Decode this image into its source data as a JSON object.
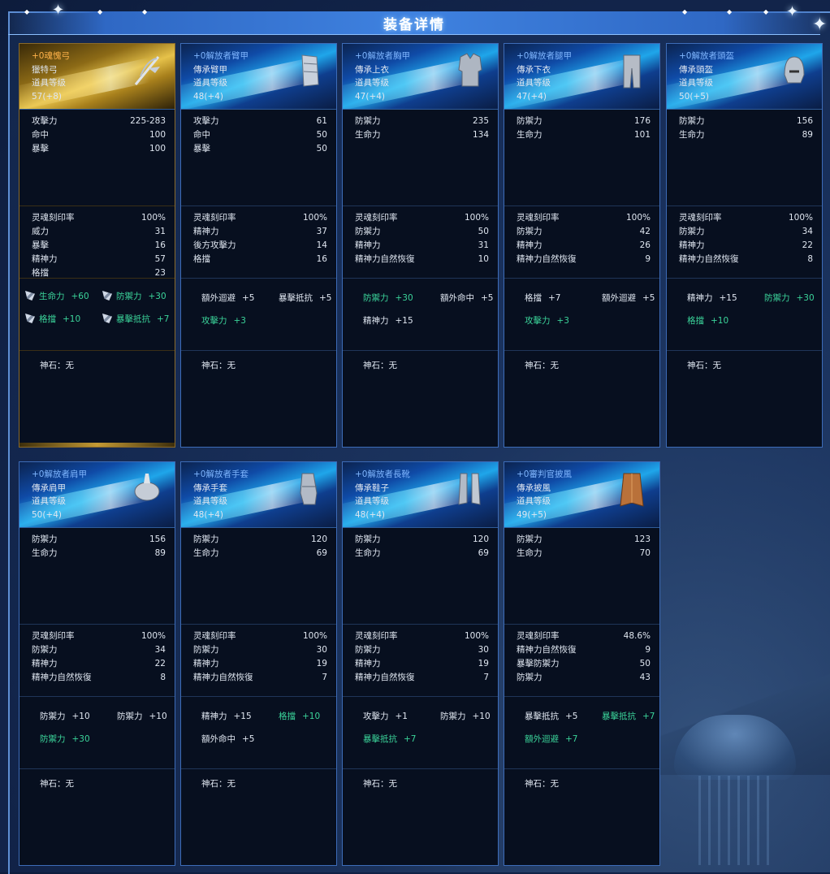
{
  "title": "装备详情",
  "stone_label": "神石",
  "stone_sep": "：",
  "cards": [
    {
      "name": "+0魂愧弓",
      "type": "獵特弓",
      "level_label": "道具等级",
      "level": "57(+8)",
      "gold": true,
      "icon": "bow-icon",
      "base": [
        [
          "攻擊力",
          "225-283"
        ],
        [
          "命中",
          "100"
        ],
        [
          "暴擊",
          "100"
        ]
      ],
      "extra": [
        [
          "灵魂刻印率",
          "100%"
        ],
        [
          "威力",
          "31"
        ],
        [
          "暴擊",
          "16"
        ],
        [
          "精神力",
          "57"
        ],
        [
          "格擋",
          "23"
        ]
      ],
      "bonus": [
        {
          "n": "生命力",
          "v": "+60",
          "g": true,
          "w": true
        },
        {
          "n": "防禦力",
          "v": "+30",
          "g": true,
          "w": true
        },
        {
          "n": "格擋",
          "v": "+10",
          "g": true,
          "w": true
        },
        {
          "n": "暴擊抵抗",
          "v": "+7",
          "g": true,
          "w": true
        }
      ],
      "stone": "无"
    },
    {
      "name": "+0解放者臂甲",
      "type": "傳承臂甲",
      "level_label": "道具等级",
      "level": "48(+4)",
      "gold": false,
      "icon": "arm-guard-icon",
      "base": [
        [
          "攻擊力",
          "61"
        ],
        [
          "命中",
          "50"
        ],
        [
          "暴擊",
          "50"
        ]
      ],
      "extra": [
        [
          "灵魂刻印率",
          "100%"
        ],
        [
          "精神力",
          "37"
        ],
        [
          "後方攻擊力",
          "14"
        ],
        [
          "格擋",
          "16"
        ]
      ],
      "bonus": [
        {
          "n": "額外迴避",
          "v": "+5",
          "g": false
        },
        {
          "n": "暴擊抵抗",
          "v": "+5",
          "g": false
        },
        {
          "n": "攻擊力",
          "v": "+3",
          "g": true
        }
      ],
      "stone": "无"
    },
    {
      "name": "+0解放者胸甲",
      "type": "傳承上衣",
      "level_label": "道具等级",
      "level": "47(+4)",
      "gold": false,
      "icon": "chest-armor-icon",
      "base": [
        [
          "防禦力",
          "235"
        ],
        [
          "生命力",
          "134"
        ]
      ],
      "extra": [
        [
          "灵魂刻印率",
          "100%"
        ],
        [
          "防禦力",
          "50"
        ],
        [
          "精神力",
          "31"
        ],
        [
          "精神力自然恢復",
          "10"
        ]
      ],
      "bonus": [
        {
          "n": "防禦力",
          "v": "+30",
          "g": true
        },
        {
          "n": "額外命中",
          "v": "+5",
          "g": false
        },
        {
          "n": "精神力",
          "v": "+15",
          "g": false
        }
      ],
      "stone": "无"
    },
    {
      "name": "+0解放者腿甲",
      "type": "傳承下衣",
      "level_label": "道具等级",
      "level": "47(+4)",
      "gold": false,
      "icon": "leg-armor-icon",
      "base": [
        [
          "防禦力",
          "176"
        ],
        [
          "生命力",
          "101"
        ]
      ],
      "extra": [
        [
          "灵魂刻印率",
          "100%"
        ],
        [
          "防禦力",
          "42"
        ],
        [
          "精神力",
          "26"
        ],
        [
          "精神力自然恢復",
          "9"
        ]
      ],
      "bonus": [
        {
          "n": "格擋",
          "v": "+7",
          "g": false
        },
        {
          "n": "額外迴避",
          "v": "+5",
          "g": false
        },
        {
          "n": "攻擊力",
          "v": "+3",
          "g": true
        }
      ],
      "stone": "无"
    },
    {
      "name": "+0解放者頭盔",
      "type": "傳承頭盔",
      "level_label": "道具等级",
      "level": "50(+5)",
      "gold": false,
      "icon": "helmet-icon",
      "base": [
        [
          "防禦力",
          "156"
        ],
        [
          "生命力",
          "89"
        ]
      ],
      "extra": [
        [
          "灵魂刻印率",
          "100%"
        ],
        [
          "防禦力",
          "34"
        ],
        [
          "精神力",
          "22"
        ],
        [
          "精神力自然恢復",
          "8"
        ]
      ],
      "bonus": [
        {
          "n": "精神力",
          "v": "+15",
          "g": false
        },
        {
          "n": "防禦力",
          "v": "+30",
          "g": true
        },
        {
          "n": "格擋",
          "v": "+10",
          "g": true
        }
      ],
      "stone": "无"
    },
    {
      "name": "+0解放者肩甲",
      "type": "傳承肩甲",
      "level_label": "道具等级",
      "level": "50(+4)",
      "gold": false,
      "icon": "shoulder-armor-icon",
      "base": [
        [
          "防禦力",
          "156"
        ],
        [
          "生命力",
          "89"
        ]
      ],
      "extra": [
        [
          "灵魂刻印率",
          "100%"
        ],
        [
          "防禦力",
          "34"
        ],
        [
          "精神力",
          "22"
        ],
        [
          "精神力自然恢復",
          "8"
        ]
      ],
      "bonus": [
        {
          "n": "防禦力",
          "v": "+10",
          "g": false
        },
        {
          "n": "防禦力",
          "v": "+10",
          "g": false
        },
        {
          "n": "防禦力",
          "v": "+30",
          "g": true
        }
      ],
      "stone": "无"
    },
    {
      "name": "+0解放者手套",
      "type": "傳承手套",
      "level_label": "道具等级",
      "level": "48(+4)",
      "gold": false,
      "icon": "gauntlet-icon",
      "base": [
        [
          "防禦力",
          "120"
        ],
        [
          "生命力",
          "69"
        ]
      ],
      "extra": [
        [
          "灵魂刻印率",
          "100%"
        ],
        [
          "防禦力",
          "30"
        ],
        [
          "精神力",
          "19"
        ],
        [
          "精神力自然恢復",
          "7"
        ]
      ],
      "bonus": [
        {
          "n": "精神力",
          "v": "+15",
          "g": false
        },
        {
          "n": "格擋",
          "v": "+10",
          "g": true
        },
        {
          "n": "額外命中",
          "v": "+5",
          "g": false
        }
      ],
      "stone": "无"
    },
    {
      "name": "+0解放者長靴",
      "type": "傳承鞋子",
      "level_label": "道具等级",
      "level": "48(+4)",
      "gold": false,
      "icon": "boots-icon",
      "base": [
        [
          "防禦力",
          "120"
        ],
        [
          "生命力",
          "69"
        ]
      ],
      "extra": [
        [
          "灵魂刻印率",
          "100%"
        ],
        [
          "防禦力",
          "30"
        ],
        [
          "精神力",
          "19"
        ],
        [
          "精神力自然恢復",
          "7"
        ]
      ],
      "bonus": [
        {
          "n": "攻擊力",
          "v": "+1",
          "g": false
        },
        {
          "n": "防禦力",
          "v": "+10",
          "g": false
        },
        {
          "n": "暴擊抵抗",
          "v": "+7",
          "g": true
        }
      ],
      "stone": "无"
    },
    {
      "name": "+0審判官披風",
      "type": "傳承披風",
      "level_label": "道具等级",
      "level": "49(+5)",
      "gold": false,
      "icon": "cape-icon",
      "base": [
        [
          "防禦力",
          "123"
        ],
        [
          "生命力",
          "70"
        ]
      ],
      "extra": [
        [
          "灵魂刻印率",
          "48.6%"
        ],
        [
          "精神力自然恢復",
          "9"
        ],
        [
          "暴擊防禦力",
          "50"
        ],
        [
          "防禦力",
          "43"
        ]
      ],
      "bonus": [
        {
          "n": "暴擊抵抗",
          "v": "+5",
          "g": false
        },
        {
          "n": "暴擊抵抗",
          "v": "+7",
          "g": true
        },
        {
          "n": "額外迴避",
          "v": "+7",
          "g": true
        }
      ],
      "stone": "无"
    }
  ]
}
